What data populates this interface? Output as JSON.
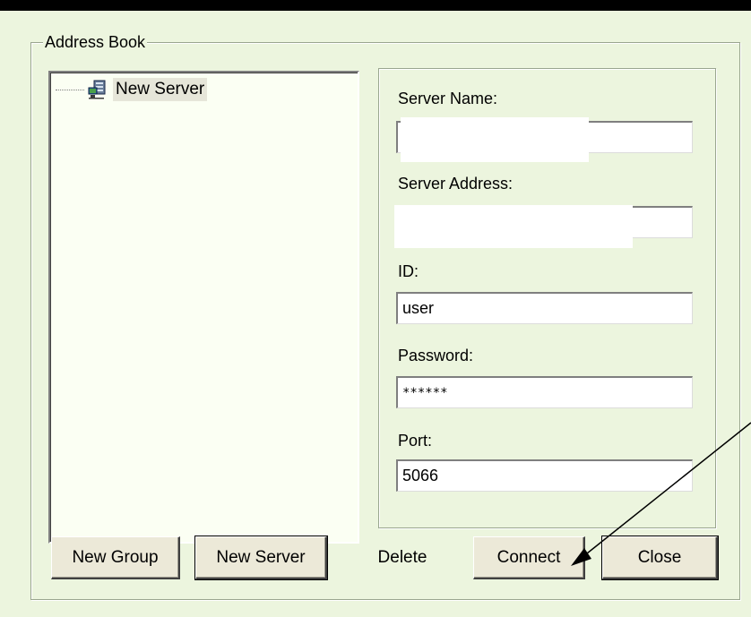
{
  "address_book": {
    "title": "Address Book",
    "tree": {
      "items": [
        {
          "label": "New Server",
          "icon": "server-icon"
        }
      ]
    },
    "details": {
      "server_name": {
        "label": "Server Name:",
        "value": ""
      },
      "server_address": {
        "label": "Server Address:",
        "value": ""
      },
      "id": {
        "label": "ID:",
        "value": "user"
      },
      "password": {
        "label": "Password:",
        "value": "******"
      },
      "port": {
        "label": "Port:",
        "value": "5066"
      }
    },
    "buttons": {
      "new_group": "New Group",
      "new_server": "New Server",
      "delete": "Delete",
      "connect": "Connect",
      "close": "Close"
    }
  },
  "colors": {
    "dialog_background": "#ecf5de",
    "tree_background": "#fbfff3",
    "button_face": "#ece9d8",
    "top_bar": "#000000"
  }
}
